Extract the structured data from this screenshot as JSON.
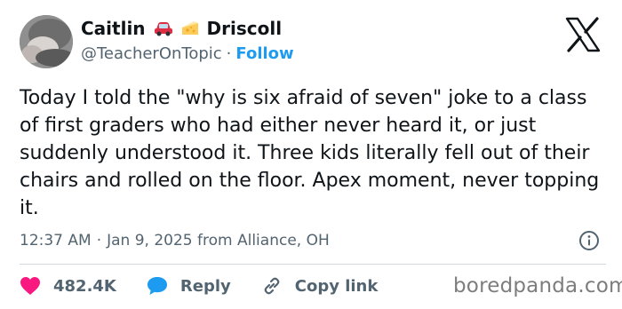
{
  "author": {
    "first_name": "Caitlin",
    "last_name": "Driscoll",
    "emojis": [
      "car-emoji",
      "cheese-emoji"
    ],
    "handle": "@TeacherOnTopic",
    "separator": "·",
    "follow_label": "Follow"
  },
  "tweet": {
    "text": "Today I told the \"why is six afraid of seven\" joke to a class of first graders who had either never heard it, or just suddenly understood it. Three kids literally fell out of their chairs and rolled on the floor. Apex moment, never topping it.",
    "time": "12:37 AM",
    "date_separator": "·",
    "date": "Jan 9, 2025 from Alliance, OH"
  },
  "actions": {
    "likes_count": "482.4K",
    "reply_label": "Reply",
    "copy_link_label": "Copy link"
  },
  "icons": {
    "platform": "x-logo-icon",
    "info": "info-icon",
    "like": "heart-icon",
    "reply": "speech-bubble-icon",
    "copy": "link-icon"
  },
  "colors": {
    "accent": "#1d9bf0",
    "like": "#f91880",
    "secondary_text": "#536471",
    "primary_text": "#0f1419"
  },
  "watermark": "boredpanda.com"
}
